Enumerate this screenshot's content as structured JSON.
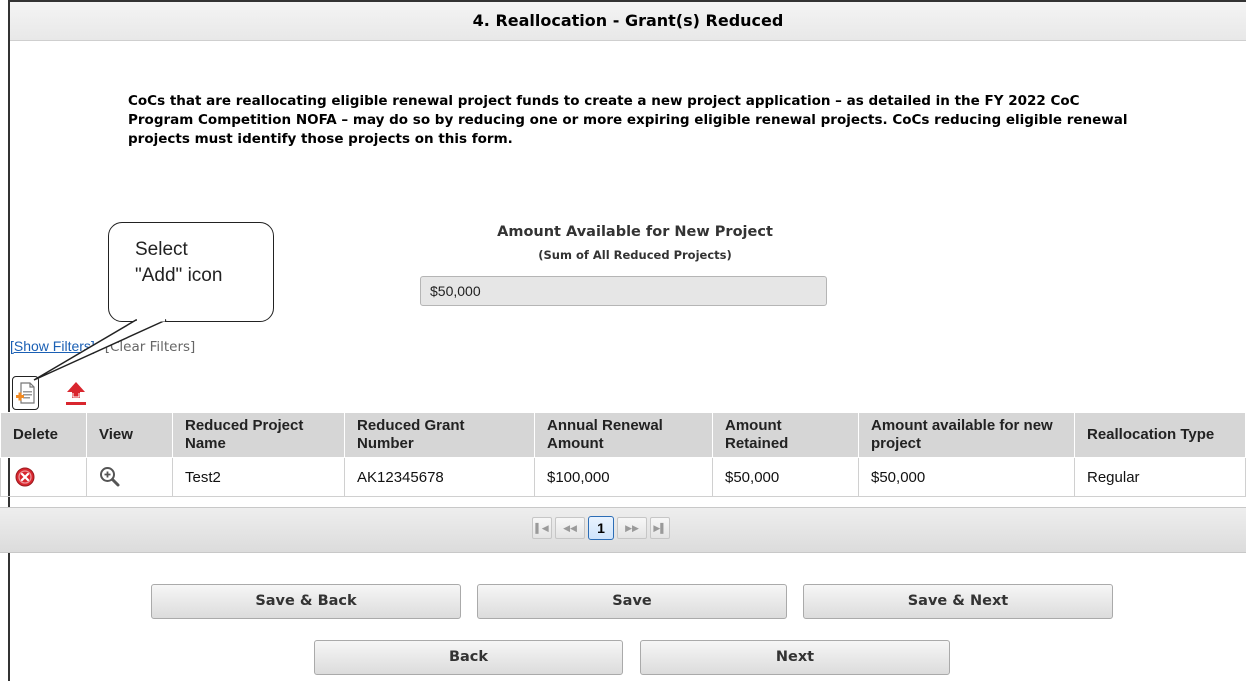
{
  "header": {
    "title": "4. Reallocation - Grant(s) Reduced"
  },
  "description": "CoCs that are reallocating eligible renewal project funds to create a new project application – as detailed in the FY 2022 CoC Program Competition NOFA – may do so by reducing one or more expiring eligible renewal projects. CoCs reducing eligible renewal projects must identify those projects on this form.",
  "amount": {
    "label": "Amount Available for New Project",
    "sublabel": "(Sum of All Reduced Projects)",
    "value": "$50,000"
  },
  "filters": {
    "show": "[Show Filters]",
    "clear": "[Clear Filters]"
  },
  "callout": {
    "line1": "Select",
    "line2": "\"Add\" icon"
  },
  "table": {
    "headers": [
      "Delete",
      "View",
      "Reduced Project Name",
      "Reduced Grant Number",
      "Annual Renewal Amount",
      "Amount Retained",
      "Amount available for new project",
      "Reallocation Type"
    ],
    "rows": [
      {
        "name": "Test2",
        "grant": "AK12345678",
        "annual": "$100,000",
        "retained": "$50,000",
        "available": "$50,000",
        "type": "Regular"
      }
    ]
  },
  "pager": {
    "current": "1"
  },
  "buttons": {
    "save_back": "Save & Back",
    "save": "Save",
    "save_next": "Save & Next",
    "back": "Back",
    "next": "Next"
  },
  "colors": {
    "delete_red": "#d9262e",
    "upload_red": "#d9262e",
    "add_orange": "#f08a24",
    "link_blue": "#1a5fb4"
  },
  "icons": {
    "add": "add-document-icon",
    "upload": "upload-icon",
    "delete": "delete-icon",
    "view": "zoom-in-icon"
  }
}
